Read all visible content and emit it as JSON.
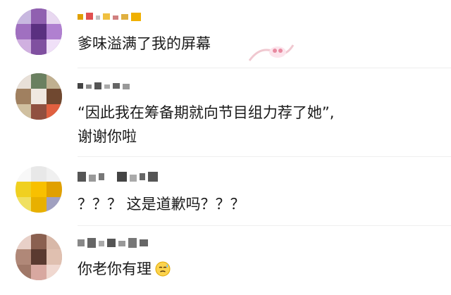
{
  "comments": [
    {
      "username": "",
      "text_line1": "爹味溢满了我的屏幕",
      "text_line2": "",
      "avatar_icon": "pixelated-avatar-icon",
      "username_colors": [
        "#f0b400",
        "#e05050",
        "#d0a000"
      ]
    },
    {
      "username": "",
      "text_line1": "“因此我在筹备期就向节目组力荐了她”,",
      "text_line2": "谢谢你啦",
      "avatar_icon": "pixelated-avatar-icon",
      "username_colors": [
        "#333333",
        "#555555",
        "#777777"
      ]
    },
    {
      "username": "",
      "text_line1": "？？？ 这是道歉吗？？？",
      "text_line2": "",
      "avatar_icon": "pixelated-avatar-icon",
      "username_colors": [
        "#444444",
        "#666666",
        "#888888"
      ]
    },
    {
      "username": "",
      "text_line1": "你老你有理",
      "text_line2": "",
      "avatar_icon": "pixelated-avatar-icon",
      "emoji_icon": "sweat-face-emoji-icon",
      "username_colors": [
        "#555555",
        "#777777",
        "#999999"
      ]
    }
  ]
}
